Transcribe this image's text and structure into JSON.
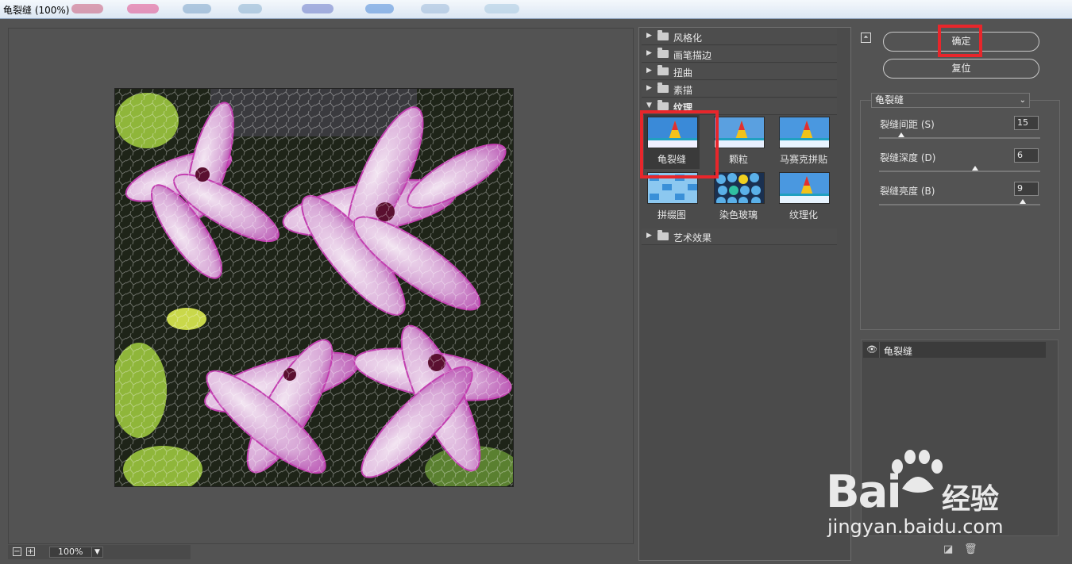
{
  "window": {
    "title": "龟裂缝 (100%)"
  },
  "preview": {
    "zoom": "100%",
    "zoom_out": "−",
    "zoom_in": "+"
  },
  "gallery": {
    "categories_top": [
      {
        "label": "风格化"
      },
      {
        "label": "画笔描边"
      },
      {
        "label": "扭曲"
      },
      {
        "label": "素描"
      }
    ],
    "open_category": {
      "label": "纹理"
    },
    "filters": [
      {
        "label": "龟裂缝",
        "selected": true
      },
      {
        "label": "颗粒",
        "selected": false
      },
      {
        "label": "马赛克拼贴",
        "selected": false
      },
      {
        "label": "拼缀图",
        "selected": false
      },
      {
        "label": "染色玻璃",
        "selected": false
      },
      {
        "label": "纹理化",
        "selected": false
      }
    ],
    "categories_bottom": [
      {
        "label": "艺术效果"
      }
    ]
  },
  "actions": {
    "ok": "确定",
    "reset": "复位"
  },
  "settings": {
    "filter_select": "龟裂缝",
    "params": [
      {
        "label": "裂缝间距 (S)",
        "value": "15"
      },
      {
        "label": "裂缝深度 (D)",
        "value": "6"
      },
      {
        "label": "裂缝亮度 (B)",
        "value": "9"
      }
    ]
  },
  "layers": {
    "items": [
      {
        "name": "龟裂缝"
      }
    ]
  },
  "watermark": {
    "brand": "Bai",
    "brand2": "经验",
    "url": "jingyan.baidu.com"
  },
  "colors": {
    "highlight": "#e8262b",
    "panel": "#535353"
  }
}
